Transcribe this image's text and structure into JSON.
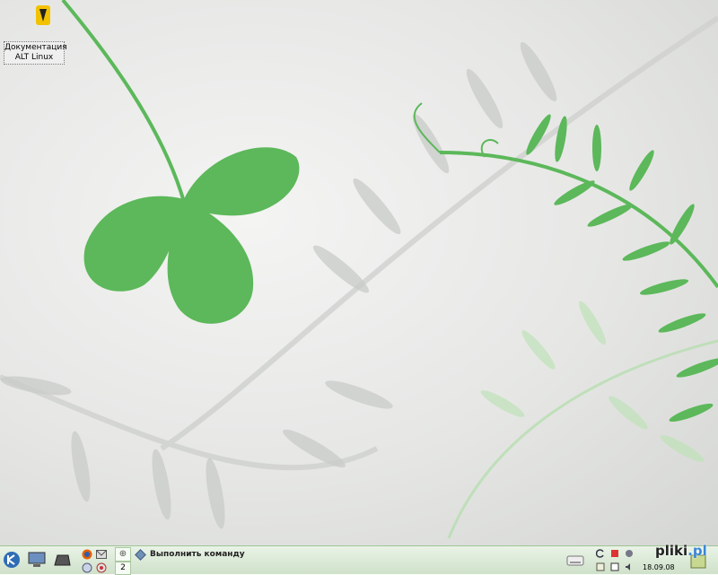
{
  "desktop": {
    "icon": {
      "logo_text_top": "alt",
      "logo_text_bottom": "linux",
      "caption_line1": "Документация",
      "caption_line2": "ALT Linux"
    }
  },
  "taskbar": {
    "run_command_label": "Выполнить команду",
    "virtual_desktop_number": "2",
    "clock_date": "18.09.08",
    "watermark_main": "pliki",
    "watermark_suffix": ".pl",
    "icons": {
      "kde_menu": "kde-menu-icon",
      "show_desktop": "show-desktop-icon",
      "terminal": "terminal-icon",
      "firefox": "firefox-icon",
      "mail": "mail-icon",
      "removable_drive": "drive-icon"
    }
  },
  "colors": {
    "leaf_green": "#5cb85a",
    "taskbar_bg": "#d9ead5",
    "accent_blue": "#3a86d8"
  }
}
